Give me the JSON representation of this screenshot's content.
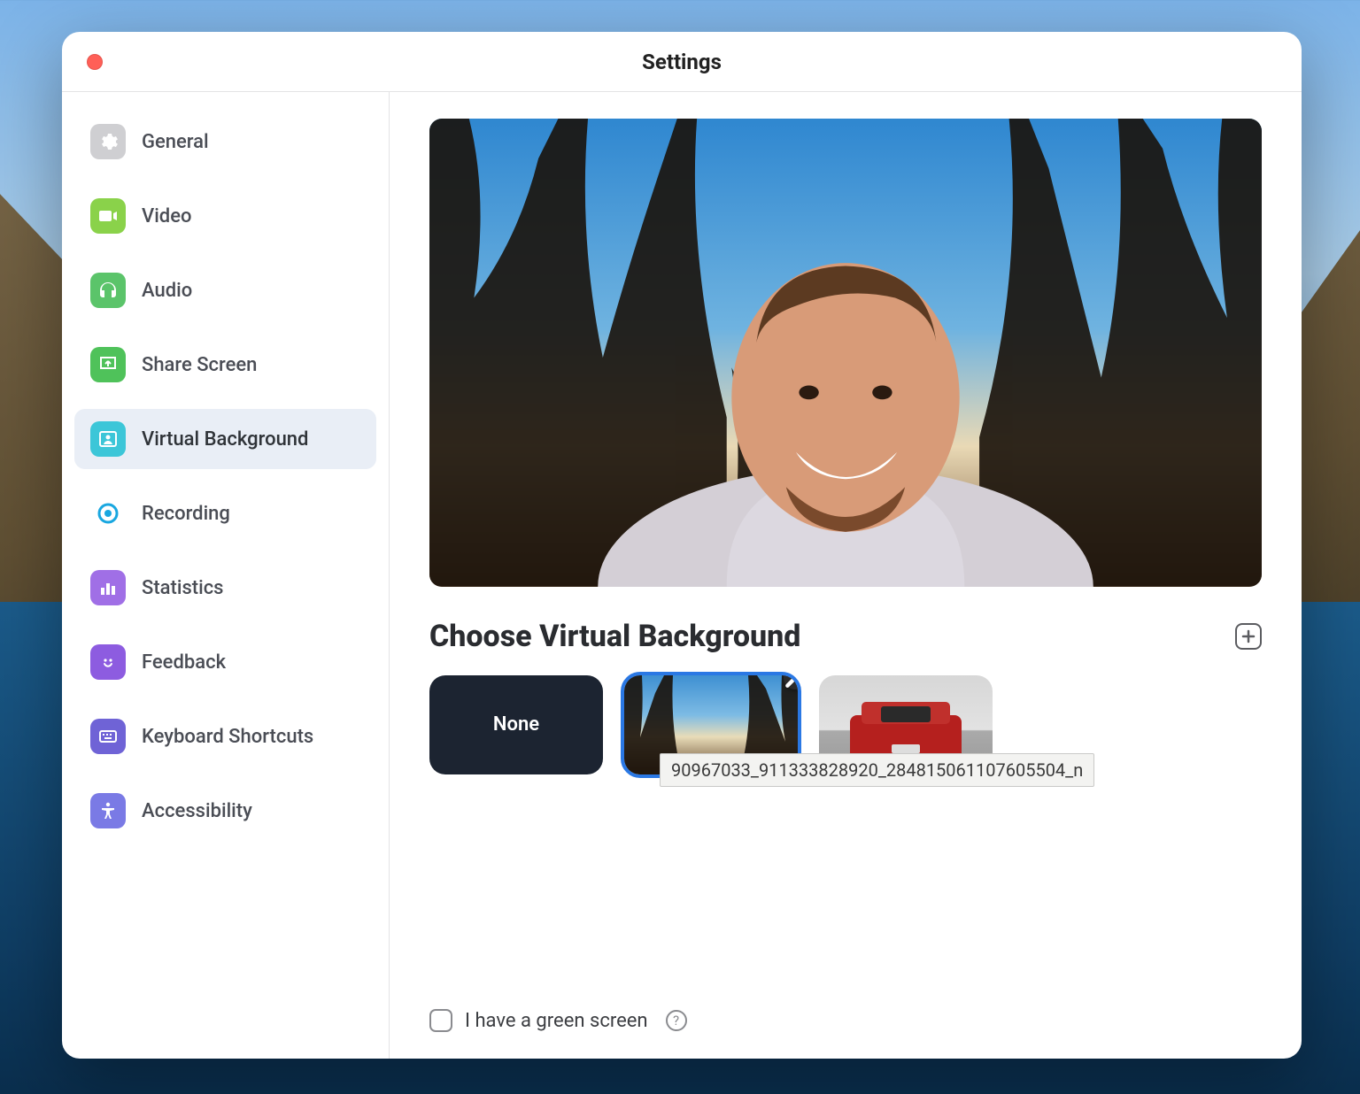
{
  "window": {
    "title": "Settings"
  },
  "sidebar": {
    "items": [
      {
        "label": "General"
      },
      {
        "label": "Video"
      },
      {
        "label": "Audio"
      },
      {
        "label": "Share Screen"
      },
      {
        "label": "Virtual Background"
      },
      {
        "label": "Recording"
      },
      {
        "label": "Statistics"
      },
      {
        "label": "Feedback"
      },
      {
        "label": "Keyboard Shortcuts"
      },
      {
        "label": "Accessibility"
      }
    ],
    "selected_index": 4
  },
  "main": {
    "section_title": "Choose Virtual Background",
    "backgrounds": {
      "none_label": "None",
      "selected_index": 1,
      "tooltip_text": "90967033_911333828920_284815061107605504_n"
    },
    "green_screen_label": "I have a green screen",
    "green_screen_checked": false
  }
}
